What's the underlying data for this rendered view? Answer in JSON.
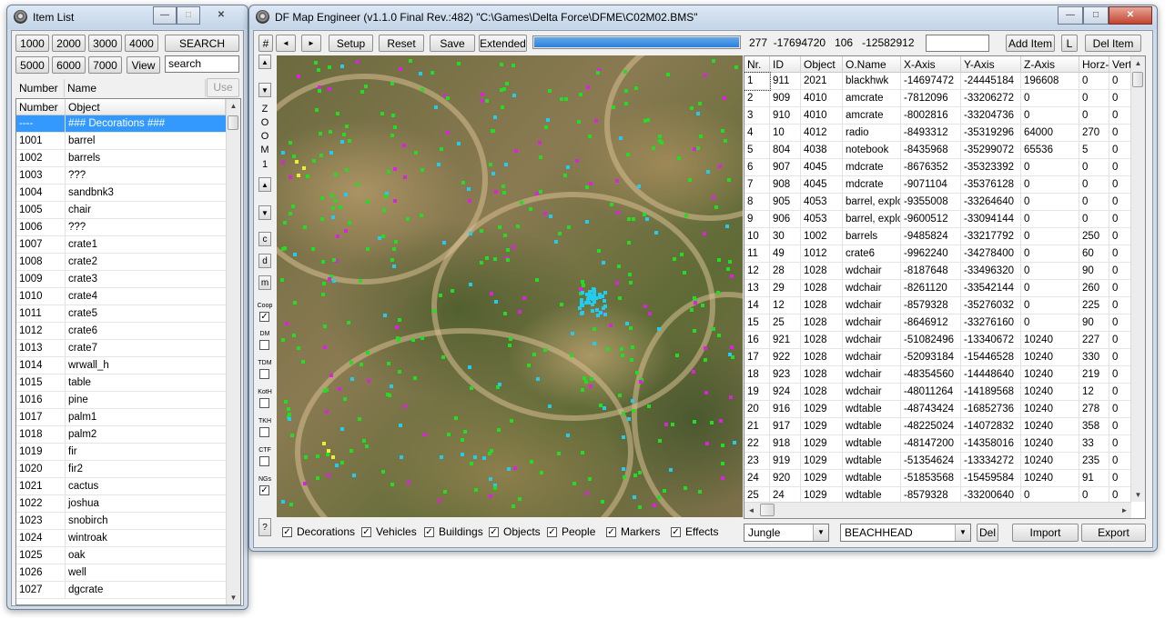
{
  "item_list_window": {
    "title": "Item List",
    "number_buttons_row1": [
      "1000",
      "2000",
      "3000",
      "4000"
    ],
    "search_button": "SEARCH",
    "number_buttons_row2": [
      "5000",
      "6000",
      "7000"
    ],
    "view_button": "View",
    "search_value": "search",
    "top_headers": [
      "Number",
      "Name"
    ],
    "use_button": "Use",
    "list_headers": [
      "Number",
      "Object"
    ],
    "items": [
      {
        "number": "----",
        "name": "### Decorations ###"
      },
      {
        "number": "1001",
        "name": "barrel"
      },
      {
        "number": "1002",
        "name": "barrels"
      },
      {
        "number": "1003",
        "name": "???"
      },
      {
        "number": "1004",
        "name": "sandbnk3"
      },
      {
        "number": "1005",
        "name": "chair"
      },
      {
        "number": "1006",
        "name": "???"
      },
      {
        "number": "1007",
        "name": "crate1"
      },
      {
        "number": "1008",
        "name": "crate2"
      },
      {
        "number": "1009",
        "name": "crate3"
      },
      {
        "number": "1010",
        "name": "crate4"
      },
      {
        "number": "1011",
        "name": "crate5"
      },
      {
        "number": "1012",
        "name": "crate6"
      },
      {
        "number": "1013",
        "name": "crate7"
      },
      {
        "number": "1014",
        "name": "wrwall_h"
      },
      {
        "number": "1015",
        "name": "table"
      },
      {
        "number": "1016",
        "name": "pine"
      },
      {
        "number": "1017",
        "name": "palm1"
      },
      {
        "number": "1018",
        "name": "palm2"
      },
      {
        "number": "1019",
        "name": "fir"
      },
      {
        "number": "1020",
        "name": "fir2"
      },
      {
        "number": "1021",
        "name": "cactus"
      },
      {
        "number": "1022",
        "name": "joshua"
      },
      {
        "number": "1023",
        "name": "snobirch"
      },
      {
        "number": "1024",
        "name": "wintroak"
      },
      {
        "number": "1025",
        "name": "oak"
      },
      {
        "number": "1026",
        "name": "well"
      },
      {
        "number": "1027",
        "name": "dgcrate"
      }
    ]
  },
  "main_window": {
    "title": "DF Map Engineer (v1.1.0 Final Rev.:482) \"C:\\Games\\Delta Force\\DFME\\C02M02.BMS\"",
    "toolbar": {
      "hash": "#",
      "prev": "◄",
      "next": "►",
      "setup": "Setup",
      "reset": "Reset",
      "save": "Save",
      "extended": "Extended",
      "progress": 1.0,
      "coords": "277  -17694720   106   -12582912",
      "add_item": "Add Item",
      "l_button": "L",
      "del_item": "Del Item"
    },
    "zoom_label": "Z O O M",
    "zoom_value": "1",
    "side_buttons": [
      "c",
      "d",
      "m"
    ],
    "game_modes": [
      {
        "label": "Coop",
        "checked": true
      },
      {
        "label": "DM",
        "checked": false
      },
      {
        "label": "TDM",
        "checked": false
      },
      {
        "label": "KotH",
        "checked": false
      },
      {
        "label": "TKH",
        "checked": false
      },
      {
        "label": "CTF",
        "checked": false
      },
      {
        "label": "NGs",
        "checked": true
      }
    ],
    "help_button": "?",
    "filters": [
      {
        "label": "Decorations",
        "checked": true
      },
      {
        "label": "Vehicles",
        "checked": true
      },
      {
        "label": "Buildings",
        "checked": true
      },
      {
        "label": "Objects",
        "checked": true
      },
      {
        "label": "People",
        "checked": true
      },
      {
        "label": "Markers",
        "checked": true
      },
      {
        "label": "Effects",
        "checked": true
      }
    ],
    "terrain_select": "Jungle",
    "name_select": "BEACHHEAD",
    "del_button": "Del",
    "import_button": "Import",
    "export_button": "Export",
    "table_headers": [
      "Nr.",
      "ID",
      "Object",
      "O.Name",
      "X-Axis",
      "Y-Axis",
      "Z-Axis",
      "Horz-A",
      "Vert"
    ],
    "rows": [
      [
        "1",
        "911",
        "2021",
        "blackhwk",
        "-14697472",
        "-24445184",
        "196608",
        "0",
        "0"
      ],
      [
        "2",
        "909",
        "4010",
        "amcrate",
        "-7812096",
        "-33206272",
        "0",
        "0",
        "0"
      ],
      [
        "3",
        "910",
        "4010",
        "amcrate",
        "-8002816",
        "-33204736",
        "0",
        "0",
        "0"
      ],
      [
        "4",
        "10",
        "4012",
        "radio",
        "-8493312",
        "-35319296",
        "64000",
        "270",
        "0"
      ],
      [
        "5",
        "804",
        "4038",
        "notebook",
        "-8435968",
        "-35299072",
        "65536",
        "5",
        "0"
      ],
      [
        "6",
        "907",
        "4045",
        "mdcrate",
        "-8676352",
        "-35323392",
        "0",
        "0",
        "0"
      ],
      [
        "7",
        "908",
        "4045",
        "mdcrate",
        "-9071104",
        "-35376128",
        "0",
        "0",
        "0"
      ],
      [
        "8",
        "905",
        "4053",
        "barrel, explos",
        "-9355008",
        "-33264640",
        "0",
        "0",
        "0"
      ],
      [
        "9",
        "906",
        "4053",
        "barrel, explos",
        "-9600512",
        "-33094144",
        "0",
        "0",
        "0"
      ],
      [
        "10",
        "30",
        "1002",
        "barrels",
        "-9485824",
        "-33217792",
        "0",
        "250",
        "0"
      ],
      [
        "11",
        "49",
        "1012",
        "crate6",
        "-9962240",
        "-34278400",
        "0",
        "60",
        "0"
      ],
      [
        "12",
        "28",
        "1028",
        "wdchair",
        "-8187648",
        "-33496320",
        "0",
        "90",
        "0"
      ],
      [
        "13",
        "29",
        "1028",
        "wdchair",
        "-8261120",
        "-33542144",
        "0",
        "260",
        "0"
      ],
      [
        "14",
        "12",
        "1028",
        "wdchair",
        "-8579328",
        "-35276032",
        "0",
        "225",
        "0"
      ],
      [
        "15",
        "25",
        "1028",
        "wdchair",
        "-8646912",
        "-33276160",
        "0",
        "90",
        "0"
      ],
      [
        "16",
        "921",
        "1028",
        "wdchair",
        "-51082496",
        "-13340672",
        "10240",
        "227",
        "0"
      ],
      [
        "17",
        "922",
        "1028",
        "wdchair",
        "-52093184",
        "-15446528",
        "10240",
        "330",
        "0"
      ],
      [
        "18",
        "923",
        "1028",
        "wdchair",
        "-48354560",
        "-14448640",
        "10240",
        "219",
        "0"
      ],
      [
        "19",
        "924",
        "1028",
        "wdchair",
        "-48011264",
        "-14189568",
        "10240",
        "12",
        "0"
      ],
      [
        "20",
        "916",
        "1029",
        "wdtable",
        "-48743424",
        "-16852736",
        "10240",
        "278",
        "0"
      ],
      [
        "21",
        "917",
        "1029",
        "wdtable",
        "-48225024",
        "-14072832",
        "10240",
        "358",
        "0"
      ],
      [
        "22",
        "918",
        "1029",
        "wdtable",
        "-48147200",
        "-14358016",
        "10240",
        "33",
        "0"
      ],
      [
        "23",
        "919",
        "1029",
        "wdtable",
        "-51354624",
        "-13334272",
        "10240",
        "235",
        "0"
      ],
      [
        "24",
        "920",
        "1029",
        "wdtable",
        "-51853568",
        "-15459584",
        "10240",
        "91",
        "0"
      ],
      [
        "25",
        "24",
        "1029",
        "wdtable",
        "-8579328",
        "-33200640",
        "0",
        "0",
        "0"
      ]
    ]
  },
  "colors": {
    "selection": "#3399ff",
    "progress": "#2d7fd8",
    "marker_green": "#22dd22",
    "marker_cyan": "#22ccee",
    "marker_magenta": "#dd22dd",
    "marker_yellow": "#eeee33"
  }
}
